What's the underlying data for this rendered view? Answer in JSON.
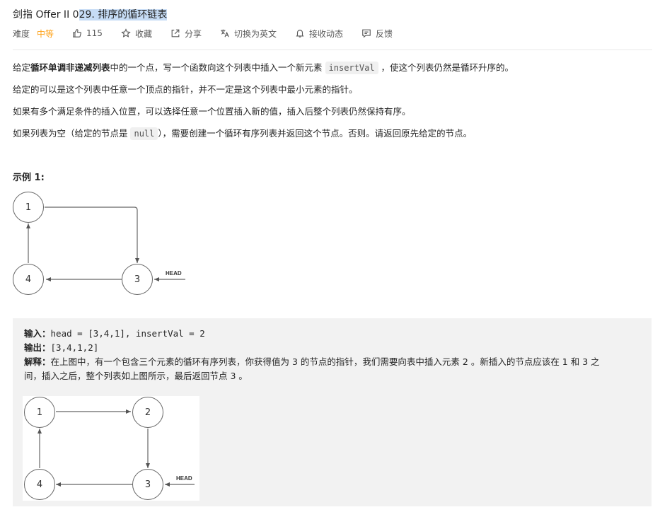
{
  "title": {
    "prefix": "剑指 Offer II 0",
    "highlight": "29. 排序的循环链表"
  },
  "meta": {
    "difficulty_label": "难度",
    "difficulty_value": "中等",
    "likes": "115",
    "favorite": "收藏",
    "share": "分享",
    "switch_lang": "切换为英文",
    "notify": "接收动态",
    "feedback": "反馈"
  },
  "colors": {
    "difficulty_medium": "#ffa116",
    "title_highlight": "#c6dcf5",
    "example_bg": "#f2f2f2"
  },
  "description": {
    "p1_a": "给定",
    "p1_bold": "循环单调非递减列表",
    "p1_b": "中的一个点，写一个函数向这个列表中插入一个新元素 ",
    "p1_code": "insertVal",
    "p1_c": " ，使这个列表仍然是循环升序的。",
    "p2": "给定的可以是这个列表中任意一个顶点的指针，并不一定是这个列表中最小元素的指针。",
    "p3": "如果有多个满足条件的插入位置，可以选择任意一个位置插入新的值，插入后整个列表仍然保持有序。",
    "p4_a": "如果列表为空（给定的节点是 ",
    "p4_code": "null",
    "p4_b": "），需要创建一个循环有序列表并返回这个节点。否则。请返回原先给定的节点。"
  },
  "example": {
    "title": "示例 1:",
    "input_label": "输入：",
    "input_value": "head = [3,4,1], insertVal = 2",
    "output_label": "输出：",
    "output_value": "[3,4,1,2]",
    "explain_label": "解释：",
    "explain_line1": "在上图中，有一个包含三个元素的循环有序列表，你获得值为 3 的节点的指针，我们需要向表中插入元素 2 。新插入的节点应该在 1 和 3 之",
    "explain_line2": "间，插入之后，整个列表如上图所示，最后返回节点 3 。"
  },
  "diagram1": {
    "nodes": [
      "1",
      "4",
      "3"
    ],
    "head_label": "HEAD"
  },
  "diagram2": {
    "nodes": [
      "1",
      "2",
      "4",
      "3"
    ],
    "head_label": "HEAD"
  },
  "icons": [
    "thumbs-up-icon",
    "star-icon",
    "share-icon",
    "translate-icon",
    "bell-icon",
    "feedback-icon"
  ]
}
